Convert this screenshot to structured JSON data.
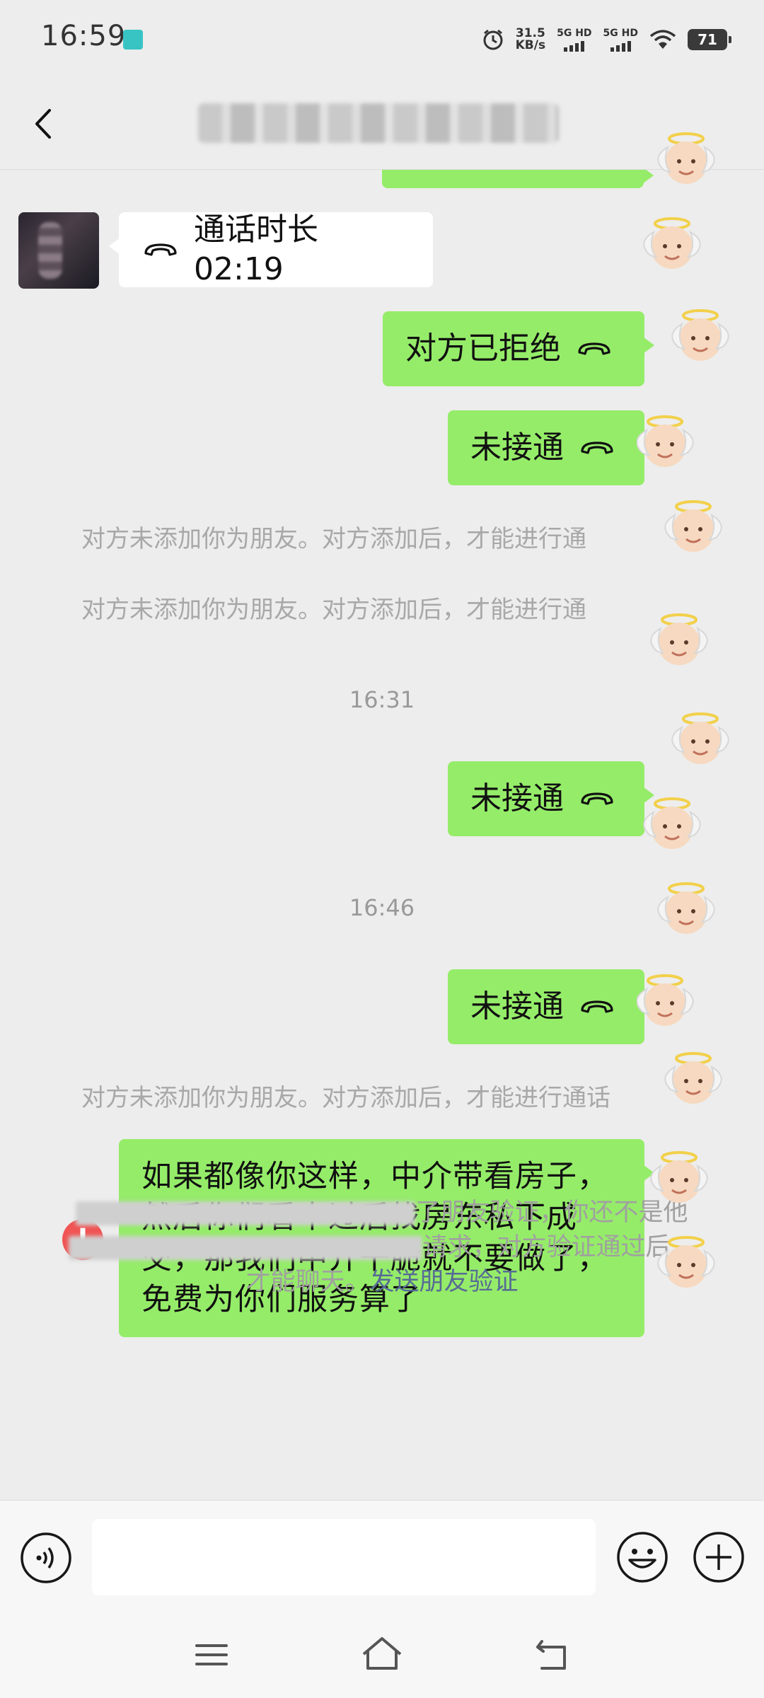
{
  "status_bar": {
    "time": "16:59",
    "net_speed_value": "31.5",
    "net_speed_unit": "KB/s",
    "sim1_label": "5G HD",
    "sim2_label": "5G HD",
    "battery": "71",
    "icons": [
      "alarm-icon",
      "wifi-icon",
      "battery-icon"
    ]
  },
  "header": {
    "title_redacted": true
  },
  "messages": {
    "call_duration": "通话时长 02:19",
    "rejected": "对方已拒绝",
    "not_connected_1": "未接通",
    "not_friend_notice_1": "对方未添加你为朋友。对方添加后，才能进行通",
    "not_friend_notice_2": "对方未添加你为朋友。对方添加后，才能进行通",
    "time_1": "16:31",
    "not_connected_2": "未接通",
    "time_2": "16:46",
    "not_connected_3": "未接通",
    "not_friend_notice_3": "对方未添加你为朋友。对方添加后，才能进行通话",
    "long_message": "如果都像你这样，中介带看房子，然后你们看中过后找房东私下成交，那我们中介干脆就不要做了，免费为你们服务算了",
    "error_mark": "!"
  },
  "verification": {
    "line1_visible": "了朋友验证，你还不是他",
    "line2_visible": "请求，对方验证通过后，",
    "line3_visible": "才能聊天。",
    "link_text": "发送朋友验证"
  },
  "input_bar": {
    "placeholder": "",
    "icons": [
      "voice-icon",
      "emoji-icon",
      "plus-icon"
    ]
  },
  "nav_bar": {
    "icons": [
      "menu-icon",
      "home-icon",
      "back-nav-icon"
    ]
  },
  "colors": {
    "outgoing_bubble": "#95ec69",
    "incoming_bubble": "#ffffff",
    "background": "#ededed",
    "link": "#576b95",
    "error": "#f05454"
  }
}
